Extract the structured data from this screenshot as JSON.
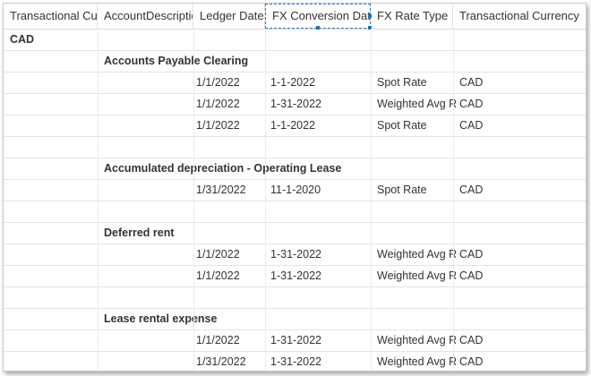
{
  "columns": [
    "Transactional Currency",
    "AccountDescription",
    "Ledger Date",
    "FX Conversion Date",
    "FX Rate Type",
    "Transactional Currency"
  ],
  "group": "CAD",
  "accounts": [
    {
      "name": "Accounts Payable Clearing",
      "rows": [
        {
          "ledger_date": "1/1/2022",
          "fx_conversion_date": "1-1-2022",
          "fx_rate_type": "Spot Rate",
          "currency": "CAD"
        },
        {
          "ledger_date": "1/1/2022",
          "fx_conversion_date": "1-31-2022",
          "fx_rate_type": "Weighted Avg Rate",
          "currency": "CAD"
        },
        {
          "ledger_date": "1/1/2022",
          "fx_conversion_date": "1-1-2022",
          "fx_rate_type": "Spot Rate",
          "currency": "CAD"
        }
      ]
    },
    {
      "name": "Accumulated depreciation - Operating Lease",
      "rows": [
        {
          "ledger_date": "1/31/2022",
          "fx_conversion_date": "11-1-2020",
          "fx_rate_type": "Spot Rate",
          "currency": "CAD"
        }
      ]
    },
    {
      "name": "Deferred rent",
      "rows": [
        {
          "ledger_date": "1/1/2022",
          "fx_conversion_date": "1-31-2022",
          "fx_rate_type": "Weighted Avg Rate",
          "currency": "CAD"
        },
        {
          "ledger_date": "1/1/2022",
          "fx_conversion_date": "1-31-2022",
          "fx_rate_type": "Weighted Avg Rate",
          "currency": "CAD"
        }
      ]
    },
    {
      "name": "Lease rental expense",
      "rows": [
        {
          "ledger_date": "1/1/2022",
          "fx_conversion_date": "1-31-2022",
          "fx_rate_type": "Weighted Avg Rate",
          "currency": "CAD"
        },
        {
          "ledger_date": "1/31/2022",
          "fx_conversion_date": "1-31-2022",
          "fx_rate_type": "Weighted Avg Rate",
          "currency": "CAD"
        }
      ]
    }
  ]
}
